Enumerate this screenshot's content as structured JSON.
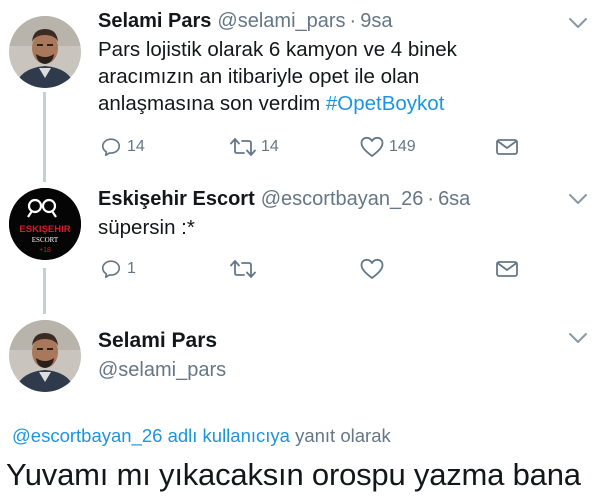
{
  "tweet1": {
    "name": "Selami Pars",
    "handle": "@selami_pars",
    "separator": "·",
    "time": "9sa",
    "text_line1": "Pars lojistik olarak 6  kamyon ve 4 binek",
    "text_line2": "aracımızın an itibariyle opet ile olan",
    "text_line3_prefix": "anlaşmasına son verdim ",
    "hashtag": "#OpetBoykot",
    "replies": "14",
    "retweets": "14",
    "likes": "149"
  },
  "tweet2": {
    "name": "Eskişehir Escort",
    "handle": "@escortbayan_26",
    "separator": "·",
    "time": "6sa",
    "text": "süpersin :*",
    "replies": "1",
    "avatar_logo": {
      "line1": "ESKIŞEHIR",
      "line2": "ESCORT",
      "line3": "+18"
    }
  },
  "profile": {
    "name": "Selami Pars",
    "handle": "@selami_pars"
  },
  "reply_context": {
    "mention": "@escortbayan_26 adlı kullanıcıya",
    "suffix": " yanıt olarak"
  },
  "main_tweet_text": "Yuvamı mı yıkacaksın orospu yazma bana",
  "colors": {
    "link": "#1b95e0",
    "muted": "#657786",
    "thread_line": "#c4d0d8",
    "escort_red": "#d11f2a"
  },
  "icons": {
    "reply": "reply-icon",
    "retweet": "retweet-icon",
    "like": "heart-icon",
    "dm": "envelope-icon",
    "menu": "chevron-down-icon"
  }
}
